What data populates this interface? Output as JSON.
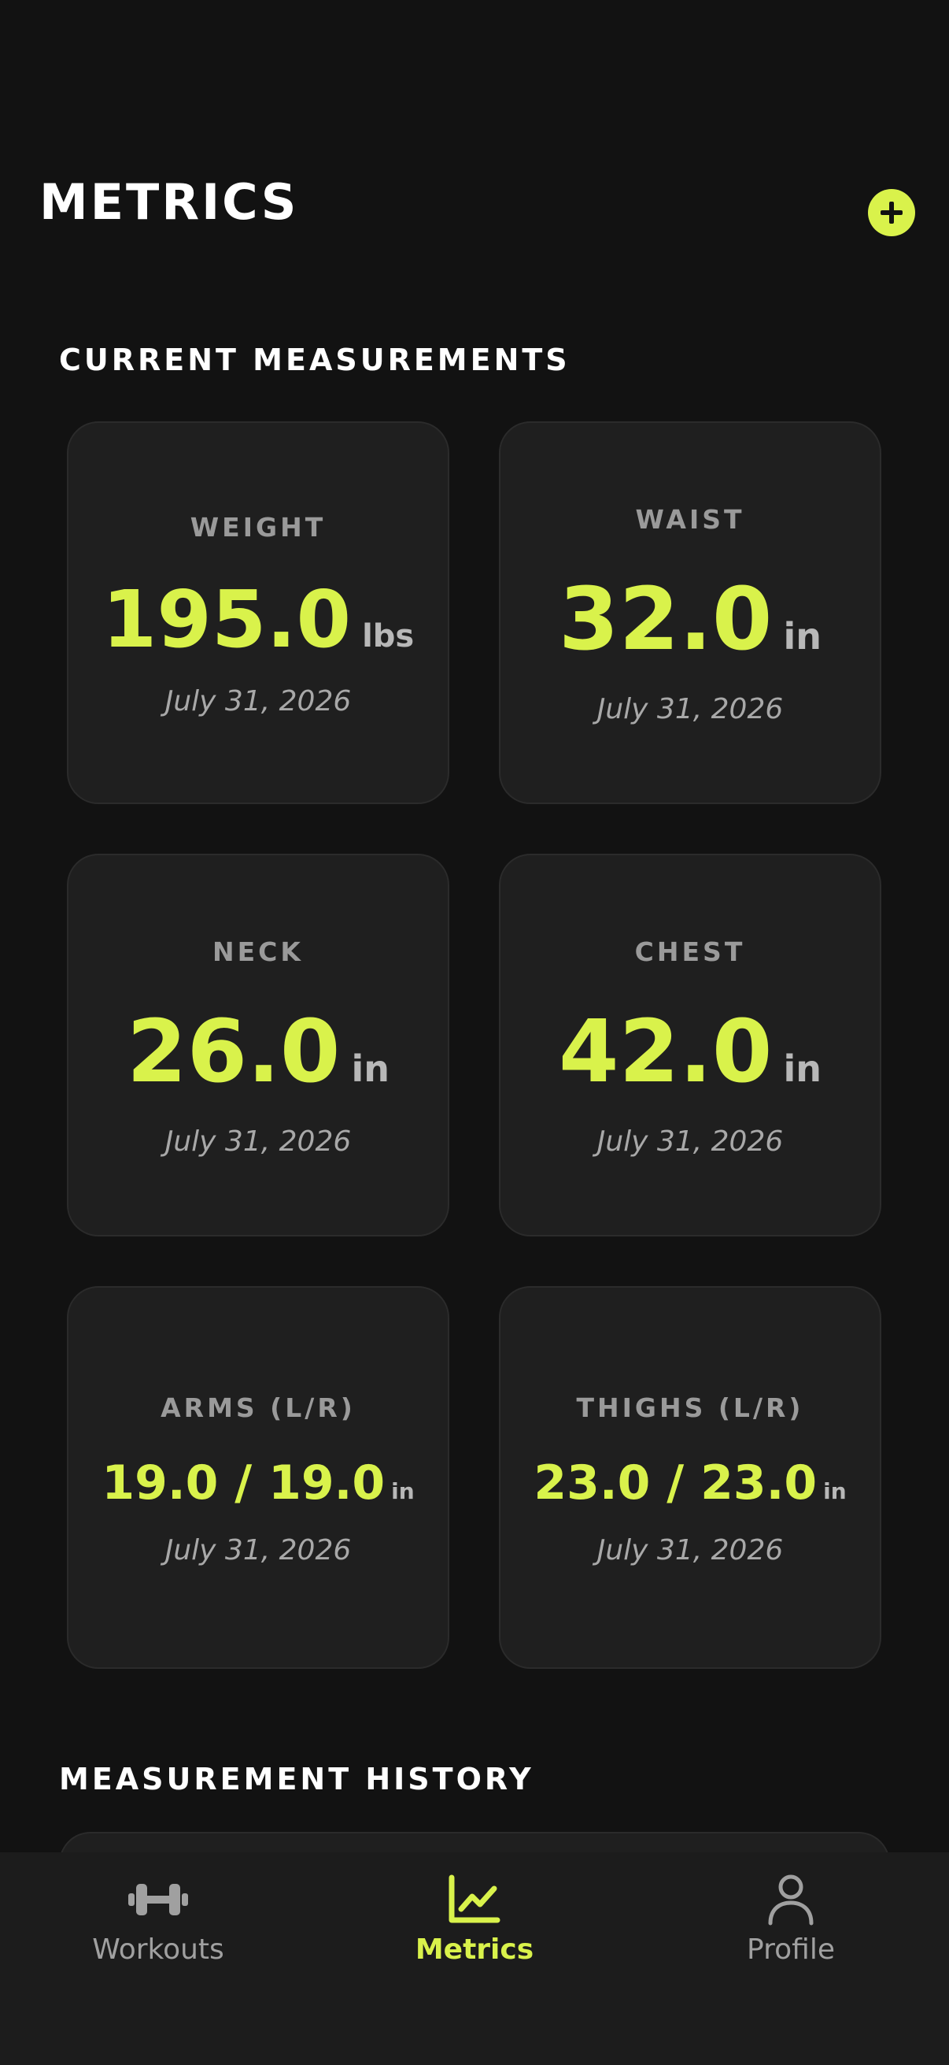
{
  "header": {
    "title": "METRICS"
  },
  "sections": {
    "current": "CURRENT MEASUREMENTS",
    "history": "MEASUREMENT HISTORY"
  },
  "cards": [
    {
      "label": "WEIGHT",
      "value": "195.0",
      "unit": "lbs",
      "date": "July 31, 2026"
    },
    {
      "label": "WAIST",
      "value": "32.0",
      "unit": "in",
      "date": "July 31, 2026"
    },
    {
      "label": "NECK",
      "value": "26.0",
      "unit": "in",
      "date": "July 31, 2026"
    },
    {
      "label": "CHEST",
      "value": "42.0",
      "unit": "in",
      "date": "July 31, 2026"
    },
    {
      "label": "ARMS (L/R)",
      "value": "19.0 / 19.0",
      "unit": "in",
      "date": "July 31, 2026"
    },
    {
      "label": "THIGHS (L/R)",
      "value": "23.0 / 23.0",
      "unit": "in",
      "date": "July 31, 2026"
    }
  ],
  "tabs": [
    {
      "label": "Workouts",
      "icon": "dumbbell-icon",
      "active": false
    },
    {
      "label": "Metrics",
      "icon": "chart-icon",
      "active": true
    },
    {
      "label": "Profile",
      "icon": "person-icon",
      "active": false
    }
  ],
  "colors": {
    "accent": "#d9f24b",
    "background": "#121212",
    "card": "#1f1f1f",
    "muted": "#9a9a9a"
  }
}
